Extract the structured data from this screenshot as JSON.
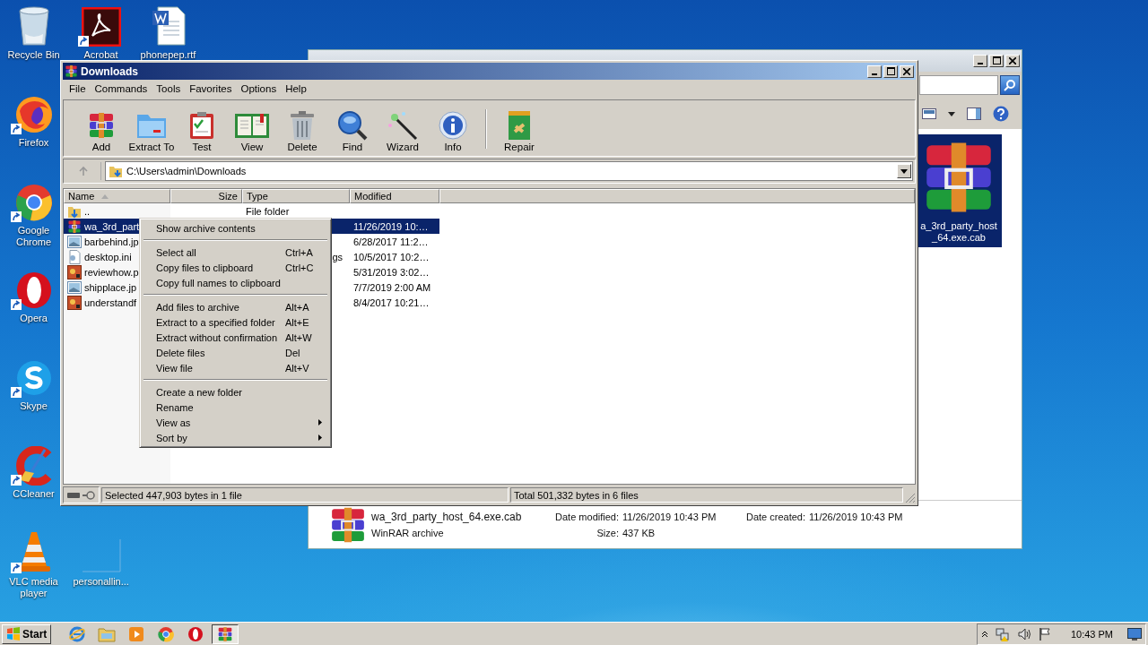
{
  "desktop_icons": [
    {
      "label": "Recycle Bin",
      "kind": "recycle",
      "shortcut": false
    },
    {
      "label": "Acrobat",
      "kind": "acrobat",
      "shortcut": true
    },
    {
      "label": "phonepep.rtf",
      "kind": "word",
      "shortcut": false
    },
    {
      "label": "Firefox",
      "kind": "firefox",
      "shortcut": true
    },
    {
      "label": "Google Chrome",
      "kind": "chrome",
      "shortcut": true
    },
    {
      "label": "Opera",
      "kind": "opera",
      "shortcut": true
    },
    {
      "label": "Skype",
      "kind": "skype",
      "shortcut": true
    },
    {
      "label": "CCleaner",
      "kind": "ccleaner",
      "shortcut": true
    },
    {
      "label": "VLC media player",
      "kind": "vlc",
      "shortcut": true
    },
    {
      "label": "personallin...",
      "kind": "blank",
      "shortcut": false
    }
  ],
  "explorer_window": {
    "tile_label_lines": [
      "a_3rd_party_host",
      "_64.exe.cab"
    ],
    "tile_selected": true,
    "details": {
      "name": "wa_3rd_party_host_64.exe.cab",
      "type": "WinRAR archive",
      "modified_label": "Date modified:",
      "modified": "11/26/2019 10:43 PM",
      "size_label": "Size:",
      "size": "437 KB",
      "created_label": "Date created:",
      "created": "11/26/2019 10:43 PM"
    }
  },
  "winrar": {
    "title": "Downloads",
    "menu": [
      "File",
      "Commands",
      "Tools",
      "Favorites",
      "Options",
      "Help"
    ],
    "toolbar": [
      {
        "label": "Add",
        "kind": "add"
      },
      {
        "label": "Extract To",
        "kind": "extract"
      },
      {
        "label": "Test",
        "kind": "test"
      },
      {
        "label": "View",
        "kind": "view"
      },
      {
        "label": "Delete",
        "kind": "delete"
      },
      {
        "label": "Find",
        "kind": "find"
      },
      {
        "label": "Wizard",
        "kind": "wizard"
      },
      {
        "label": "Info",
        "kind": "info"
      },
      {
        "label": "Repair",
        "kind": "repair"
      }
    ],
    "path": "C:\\Users\\admin\\Downloads",
    "columns": [
      {
        "label": "Name",
        "sorted": true
      },
      {
        "label": "Size",
        "sorted": false
      },
      {
        "label": "Type",
        "sorted": false
      },
      {
        "label": "Modified",
        "sorted": false
      }
    ],
    "rows": [
      {
        "name": "..",
        "kind": "parent",
        "type": "File folder",
        "selected": false
      },
      {
        "name": "wa_3rd_part",
        "kind": "archive",
        "modified": "11/26/2019 10:…",
        "selected": true
      },
      {
        "name": "barbehind.jp",
        "kind": "image",
        "modified": "6/28/2017 11:2…",
        "selected": false
      },
      {
        "name": "desktop.ini",
        "kind": "settings",
        "type": "gs",
        "modified": "10/5/2017 10:2…",
        "selected": false
      },
      {
        "name": "reviewhow.p",
        "kind": "media",
        "modified": "5/31/2019 3:02…",
        "selected": false
      },
      {
        "name": "shipplace.jp",
        "kind": "image",
        "modified": "7/7/2019 2:00 AM",
        "selected": false
      },
      {
        "name": "understandf",
        "kind": "media",
        "modified": "8/4/2017 10:21…",
        "selected": false
      }
    ],
    "status_left": "Selected 447,903 bytes in 1 file",
    "status_right": "Total 501,332 bytes in 6 files"
  },
  "context_menu": {
    "groups": [
      [
        {
          "label": "Show archive contents",
          "submenu": false
        }
      ],
      [
        {
          "label": "Select all",
          "shortcut": "Ctrl+A",
          "submenu": false
        },
        {
          "label": "Copy files to clipboard",
          "shortcut": "Ctrl+C",
          "submenu": false
        },
        {
          "label": "Copy full names to clipboard",
          "submenu": false
        }
      ],
      [
        {
          "label": "Add files to archive",
          "shortcut": "Alt+A",
          "submenu": false
        },
        {
          "label": "Extract to a specified folder",
          "shortcut": "Alt+E",
          "submenu": false
        },
        {
          "label": "Extract without confirmation",
          "shortcut": "Alt+W",
          "submenu": false
        },
        {
          "label": "Delete files",
          "shortcut": "Del",
          "submenu": false
        },
        {
          "label": "View file",
          "shortcut": "Alt+V",
          "submenu": false
        }
      ],
      [
        {
          "label": "Create a new folder",
          "submenu": false
        },
        {
          "label": "Rename",
          "submenu": false
        },
        {
          "label": "View as",
          "submenu": true
        },
        {
          "label": "Sort by",
          "submenu": true
        }
      ]
    ]
  },
  "taskbar": {
    "start": "Start",
    "apps": [
      {
        "kind": "ie",
        "active": false
      },
      {
        "kind": "explorer",
        "active": false
      },
      {
        "kind": "media",
        "active": false
      },
      {
        "kind": "chrome",
        "active": false
      },
      {
        "kind": "opera",
        "active": false
      },
      {
        "kind": "winrar",
        "active": true
      }
    ],
    "clock": "10:43 PM"
  }
}
